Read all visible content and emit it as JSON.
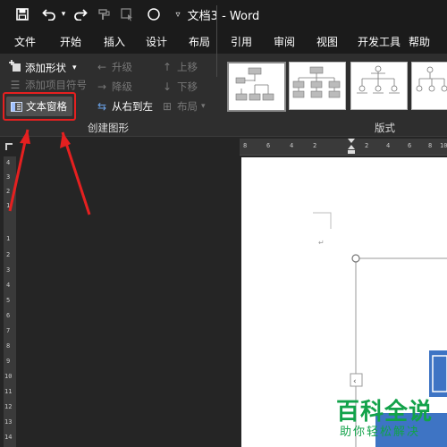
{
  "window": {
    "title": "文档3  -  Word"
  },
  "menu": [
    "文件",
    "开始",
    "插入",
    "设计",
    "布局",
    "引用",
    "审阅",
    "视图",
    "开发工具",
    "帮助"
  ],
  "ribbon": {
    "create_graphic": {
      "add_shape": "添加形状",
      "add_bullet": "添加项目符号",
      "text_pane": "文本窗格",
      "promote": "升级",
      "demote": "降级",
      "right_to_left": "从右到左",
      "move_up": "上移",
      "move_down": "下移",
      "layout": "布局",
      "group_label": "创建图形"
    },
    "layouts_label": "版式"
  },
  "ruler": {
    "h_ticks": [
      "8",
      "6",
      "4",
      "2",
      "2",
      "4",
      "6",
      "8",
      "10"
    ],
    "v_ticks": [
      "4",
      "3",
      "2",
      "1",
      "1",
      "2",
      "3",
      "4",
      "5",
      "6",
      "7",
      "8",
      "9",
      "10",
      "11",
      "12",
      "13",
      "14"
    ]
  },
  "watermark": {
    "title": "百科全说",
    "subtitle": "助你轻松解决"
  },
  "colors": {
    "annotation": "#e52020",
    "watermark": "#12a24a",
    "smartart": "#3e74c4"
  }
}
